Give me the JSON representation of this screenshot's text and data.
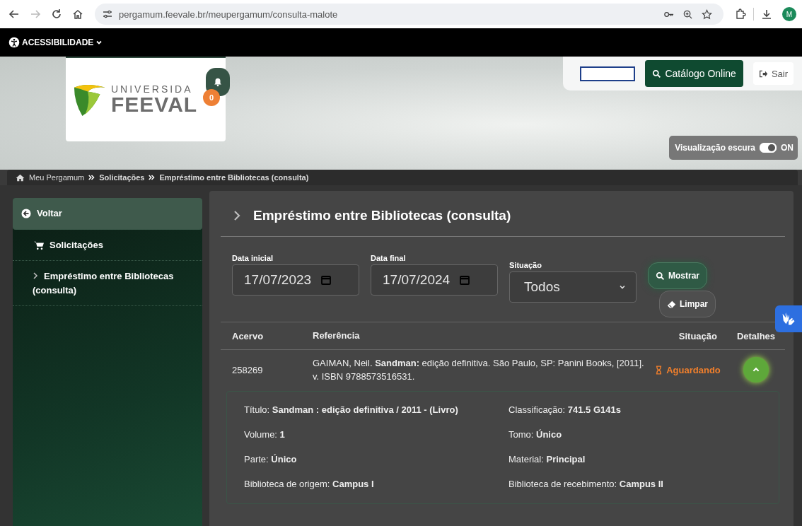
{
  "browser": {
    "url": "pergamum.feevale.br/meupergamum/consulta-malote",
    "back_disabled": false,
    "forward_disabled": true,
    "avatar": "M"
  },
  "accessibility_bar": {
    "label": "ACESSIBILIDADE"
  },
  "header": {
    "logo_top": "UNIVERSIDA",
    "logo_bottom": "FEEVAL",
    "notifications": "0",
    "catalog_button": "Catálogo Online",
    "logout_button": "Sair",
    "dark_mode": {
      "label": "Visualização escura",
      "on": true,
      "state_text": "ON"
    }
  },
  "breadcrumb": [
    {
      "label": "Meu Pergamum",
      "kind": "home"
    },
    {
      "label": "Solicitações",
      "kind": "link"
    },
    {
      "label": "Empréstimo entre Bibliotecas (consulta)",
      "kind": "link"
    }
  ],
  "sidebar": {
    "items": [
      {
        "label": "Voltar",
        "kind": "back",
        "selected": true
      },
      {
        "label": "Solicitações",
        "kind": "cart",
        "selected": false
      },
      {
        "label": "Empréstimo entre Bibliotecas (consulta)",
        "kind": "sub",
        "selected": false
      }
    ]
  },
  "page_title": "Empréstimo entre Bibliotecas (consulta)",
  "filters": {
    "start": {
      "label": "Data inicial",
      "value": "17/07/2023"
    },
    "end": {
      "label": "Data final",
      "value": "17/07/2024"
    },
    "status": {
      "label": "Situação",
      "value": "Todos"
    },
    "show_button": "Mostrar",
    "clear_button": "Limpar"
  },
  "table": {
    "columns": [
      "Acervo",
      "Referência",
      "Situação",
      "Detalhes"
    ],
    "rows": [
      {
        "acervo": "258269",
        "reference": "GAIMAN, Neil. **Sandman:** edição definitiva. São Paulo, SP: Panini Books, [2011]. v. ISBN 9788573516531.",
        "status": "Aguardando",
        "expanded": true,
        "details": [
          "Título: **Sandman : edição definitiva / 2011 - (Livro)**",
          "Classificação: **741.5 G141s**",
          "Volume: **1**",
          "Tomo: **Único**",
          "Parte: **Único**",
          "Material: **Principal**",
          "Biblioteca de origem: **Campus I**",
          "Biblioteca de recebimento: **Campus II**"
        ]
      }
    ]
  }
}
